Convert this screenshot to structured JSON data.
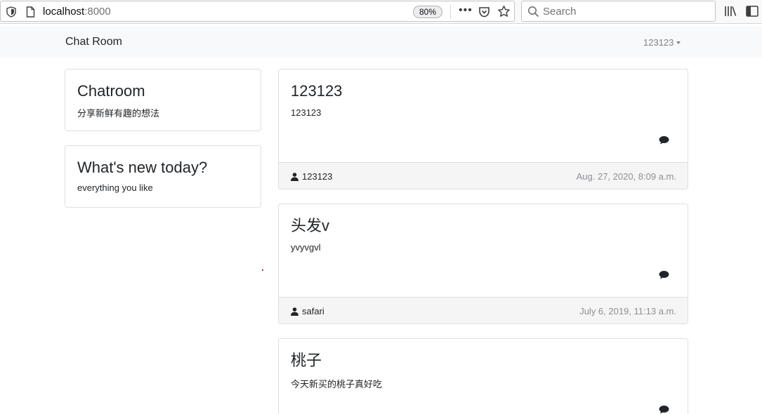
{
  "browser": {
    "url_host": "localhost",
    "url_port": ":8000",
    "zoom": "80%",
    "more_dots": "•••",
    "search_placeholder": "Search"
  },
  "navbar": {
    "brand": "Chat Room",
    "user": "123123"
  },
  "sidebar": {
    "cards": [
      {
        "title": "Chatroom",
        "text": "分享新鲜有趣的想法"
      },
      {
        "title": "What's new today?",
        "text": "everything you like"
      }
    ]
  },
  "posts": [
    {
      "title": "123123",
      "content": "123123",
      "author": "123123",
      "date": "Aug. 27, 2020, 8:09 a.m."
    },
    {
      "title": "头发v",
      "content": "yvyvgvl",
      "author": "safari",
      "date": "July 6, 2019, 11:13 a.m."
    },
    {
      "title": "桃子",
      "content": "今天新买的桃子真好吃",
      "author": "",
      "date": ""
    }
  ]
}
